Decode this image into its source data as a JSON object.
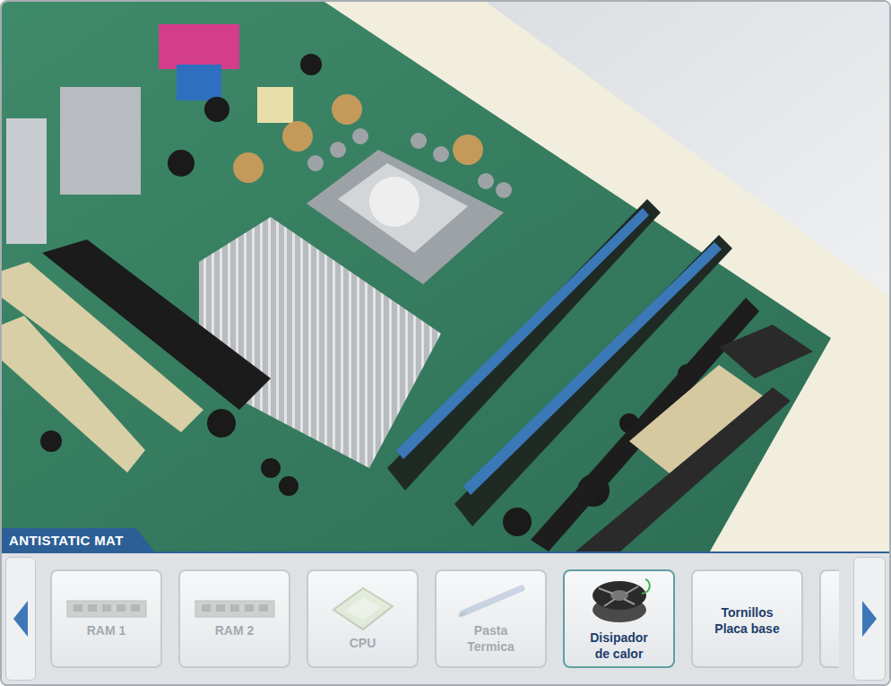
{
  "scene": {
    "label": "ANTISTATIC MAT"
  },
  "toolbar": {
    "items": [
      {
        "kind": "ram",
        "lines": [
          "RAM 1"
        ],
        "disabled": true,
        "highlighted": false
      },
      {
        "kind": "ram",
        "lines": [
          "RAM 2"
        ],
        "disabled": true,
        "highlighted": false
      },
      {
        "kind": "cpu",
        "lines": [
          "CPU"
        ],
        "disabled": true,
        "highlighted": false
      },
      {
        "kind": "paste",
        "lines": [
          "Pasta",
          "Termica"
        ],
        "disabled": true,
        "highlighted": false
      },
      {
        "kind": "heatsink",
        "lines": [
          "Disipador",
          "de calor"
        ],
        "disabled": false,
        "highlighted": true
      },
      {
        "kind": "text",
        "lines": [
          "Tornillos",
          "Placa base"
        ],
        "disabled": false,
        "highlighted": false
      },
      {
        "kind": "card",
        "lines": [],
        "disabled": false,
        "highlighted": false
      }
    ]
  }
}
